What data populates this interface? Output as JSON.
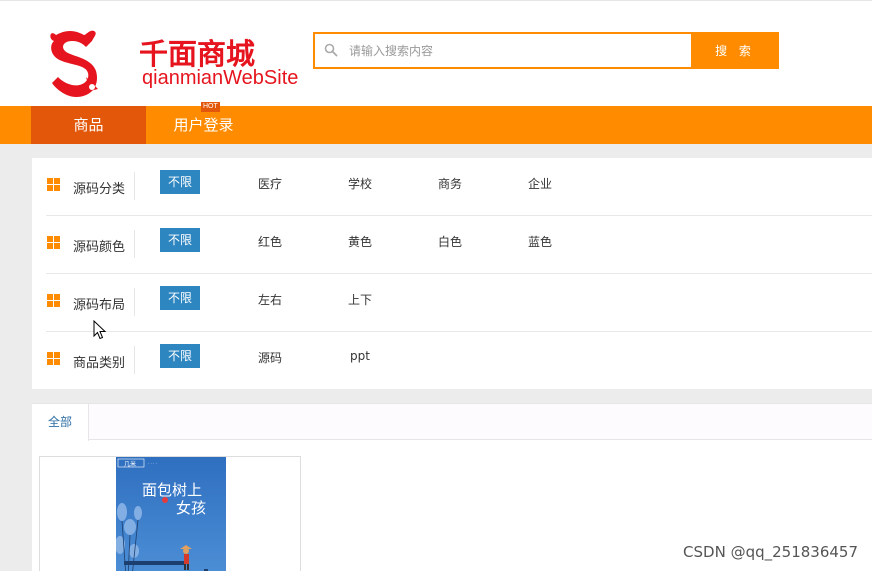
{
  "header": {
    "logo_title": "千面商城",
    "logo_subtitle": "qianmianWebSite"
  },
  "search": {
    "placeholder": "请输入搜索内容",
    "button_label": "搜 索"
  },
  "nav": {
    "items": [
      {
        "label": "商品",
        "active": true
      },
      {
        "label": "用户登录",
        "active": false
      }
    ],
    "hot_badge": "HOT"
  },
  "filters": [
    {
      "label": "源码分类",
      "selected": "不限",
      "options": [
        "医疗",
        "学校",
        "商务",
        "企业"
      ]
    },
    {
      "label": "源码颜色",
      "selected": "不限",
      "options": [
        "红色",
        "黄色",
        "白色",
        "蓝色"
      ]
    },
    {
      "label": "源码布局",
      "selected": "不限",
      "options": [
        "左右",
        "上下"
      ]
    },
    {
      "label": "商品类别",
      "selected": "不限",
      "options": [
        "源码",
        "ppt"
      ]
    }
  ],
  "results": {
    "tab_label": "全部"
  },
  "product": {
    "cover_title_line1": "面包树上",
    "cover_title_line2": "女孩"
  },
  "watermark": "CSDN @qq_251836457",
  "colors": {
    "brand_orange": "#ff8c00",
    "nav_active": "#e2570a",
    "logo_red": "#e6141e",
    "tag_blue": "#2e86c1"
  }
}
